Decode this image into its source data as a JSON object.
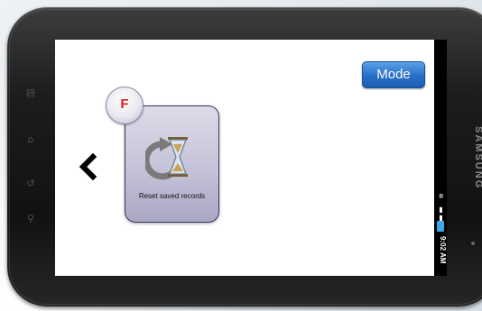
{
  "screen": {
    "mode_button_label": "Mode",
    "badge_letter": "F",
    "tile": {
      "label": "Reset saved records",
      "icon": "hourglass-reset-icon"
    },
    "back_icon": "chevron-left-icon"
  },
  "status_bar": {
    "time": "9:02 AM",
    "icons": [
      "wifi-icon",
      "signal-icon",
      "battery-icon"
    ]
  },
  "device": {
    "brand": "SAMSUNG",
    "left_buttons": [
      "menu-icon",
      "home-icon",
      "back-icon",
      "search-icon"
    ]
  },
  "colors": {
    "mode_button": "#2a6fc8",
    "badge_letter": "#e01818",
    "tile_fill": "#c2c0d6",
    "battery": "#3da7e8"
  }
}
